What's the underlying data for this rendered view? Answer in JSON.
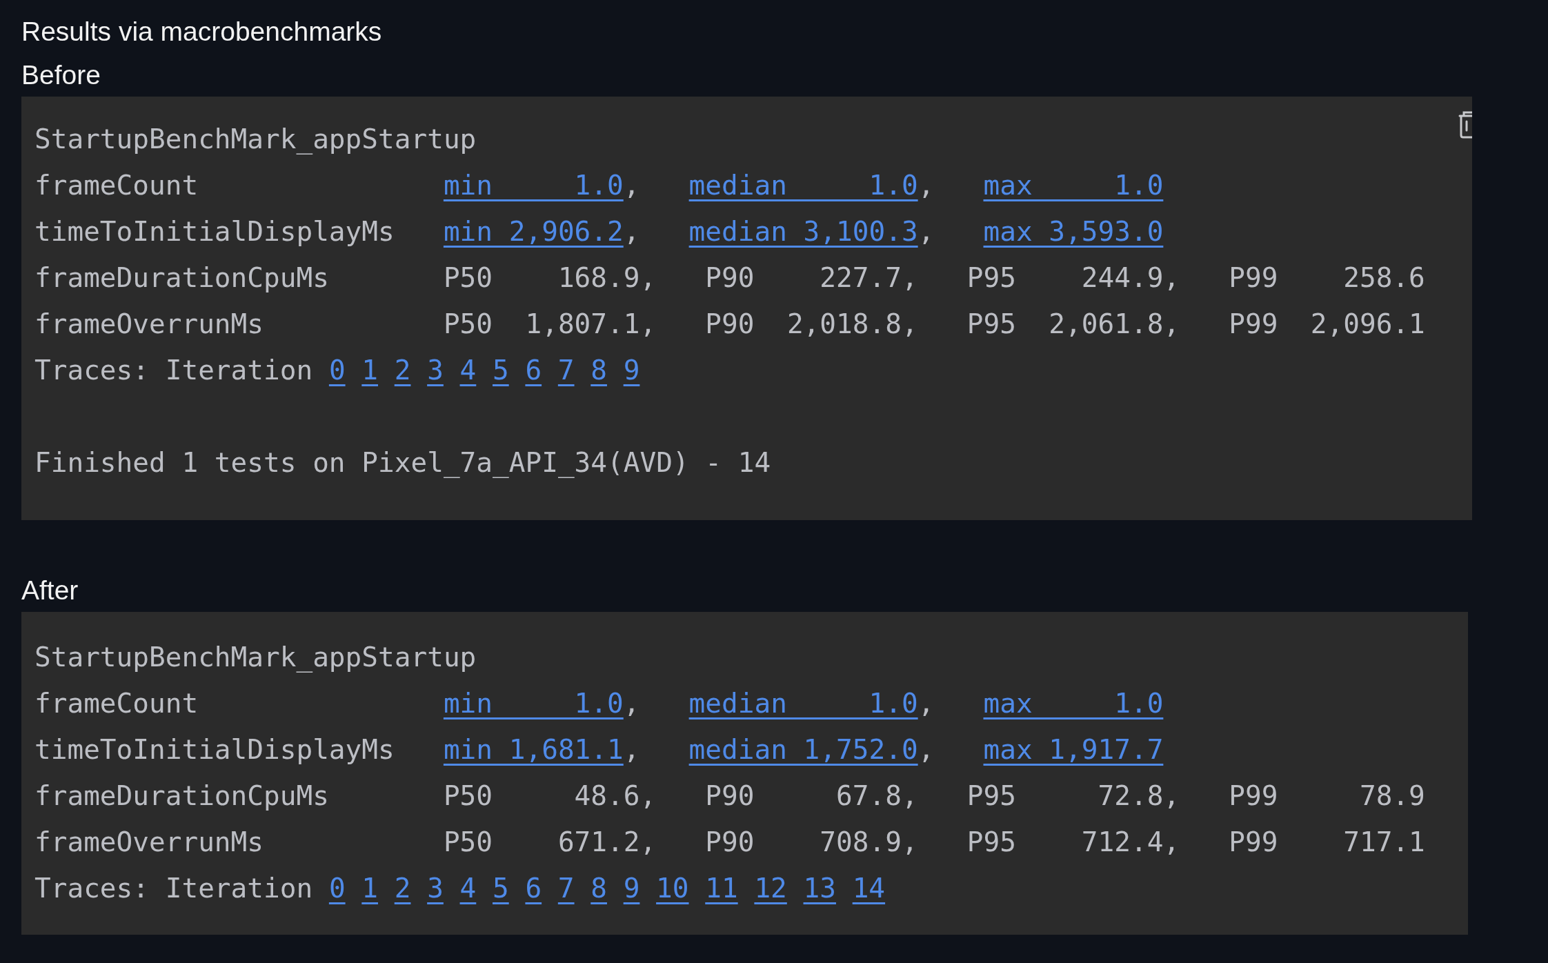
{
  "title": "Results via macrobenchmarks",
  "sections": [
    {
      "heading": "Before",
      "trash_button": true,
      "lines": [
        {
          "kind": "header",
          "text": "StartupBenchMark_appStartup"
        },
        {
          "kind": "metric",
          "name": "frameCount",
          "cells": [
            {
              "text": "min     1.0",
              "link": true,
              "suffix": ","
            },
            {
              "text": "median     1.0",
              "link": true,
              "suffix": ","
            },
            {
              "text": "max     1.0",
              "link": true
            }
          ]
        },
        {
          "kind": "metric",
          "name": "timeToInitialDisplayMs",
          "cells": [
            {
              "text": "min 2,906.2",
              "link": true,
              "suffix": ","
            },
            {
              "text": "median 3,100.3",
              "link": true,
              "suffix": ","
            },
            {
              "text": "max 3,593.0",
              "link": true
            }
          ]
        },
        {
          "kind": "metric",
          "name": "frameDurationCpuMs",
          "cells": [
            {
              "text": "P50    168.9",
              "link": false,
              "suffix": ","
            },
            {
              "text": "P90    227.7",
              "link": false,
              "suffix": ","
            },
            {
              "text": "P95    244.9",
              "link": false,
              "suffix": ","
            },
            {
              "text": "P99    258.6",
              "link": false
            }
          ]
        },
        {
          "kind": "metric",
          "name": "frameOverrunMs",
          "cells": [
            {
              "text": "P50  1,807.1",
              "link": false,
              "suffix": ","
            },
            {
              "text": "P90  2,018.8",
              "link": false,
              "suffix": ","
            },
            {
              "text": "P95  2,061.8",
              "link": false,
              "suffix": ","
            },
            {
              "text": "P99  2,096.1",
              "link": false
            }
          ]
        },
        {
          "kind": "traces",
          "label": "Traces: Iteration",
          "links": [
            "0",
            "1",
            "2",
            "3",
            "4",
            "5",
            "6",
            "7",
            "8",
            "9"
          ]
        },
        {
          "kind": "text",
          "text": "Finished 1 tests on Pixel_7a_API_34(AVD) - 14"
        }
      ]
    },
    {
      "heading": "After",
      "trash_button": false,
      "lines": [
        {
          "kind": "header",
          "text": "StartupBenchMark_appStartup"
        },
        {
          "kind": "metric",
          "name": "frameCount",
          "cells": [
            {
              "text": "min     1.0",
              "link": true,
              "suffix": ","
            },
            {
              "text": "median     1.0",
              "link": true,
              "suffix": ","
            },
            {
              "text": "max     1.0",
              "link": true
            }
          ]
        },
        {
          "kind": "metric",
          "name": "timeToInitialDisplayMs",
          "cells": [
            {
              "text": "min 1,681.1",
              "link": true,
              "suffix": ","
            },
            {
              "text": "median 1,752.0",
              "link": true,
              "suffix": ","
            },
            {
              "text": "max 1,917.7",
              "link": true
            }
          ]
        },
        {
          "kind": "metric",
          "name": "frameDurationCpuMs",
          "cells": [
            {
              "text": "P50     48.6",
              "link": false,
              "suffix": ","
            },
            {
              "text": "P90     67.8",
              "link": false,
              "suffix": ","
            },
            {
              "text": "P95     72.8",
              "link": false,
              "suffix": ","
            },
            {
              "text": "P99     78.9",
              "link": false
            }
          ]
        },
        {
          "kind": "metric",
          "name": "frameOverrunMs",
          "cells": [
            {
              "text": "P50    671.2",
              "link": false,
              "suffix": ","
            },
            {
              "text": "P90    708.9",
              "link": false,
              "suffix": ","
            },
            {
              "text": "P95    712.4",
              "link": false,
              "suffix": ","
            },
            {
              "text": "P99    717.1",
              "link": false
            }
          ]
        },
        {
          "kind": "traces",
          "label": "Traces: Iteration",
          "links": [
            "0",
            "1",
            "2",
            "3",
            "4",
            "5",
            "6",
            "7",
            "8",
            "9",
            "10",
            "11",
            "12",
            "13",
            "14"
          ]
        }
      ]
    }
  ]
}
